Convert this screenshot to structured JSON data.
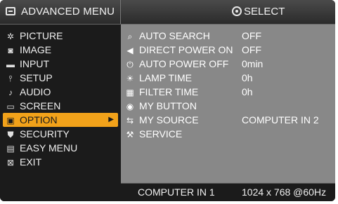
{
  "header": {
    "title": "ADVANCED MENU",
    "select_label": "SELECT"
  },
  "sidebar": {
    "items": [
      {
        "label": "PICTURE",
        "icon": "picture-icon"
      },
      {
        "label": "IMAGE",
        "icon": "image-icon"
      },
      {
        "label": "INPUT",
        "icon": "input-icon"
      },
      {
        "label": "SETUP",
        "icon": "setup-icon"
      },
      {
        "label": "AUDIO",
        "icon": "audio-icon"
      },
      {
        "label": "SCREEN",
        "icon": "screen-icon"
      },
      {
        "label": "OPTION",
        "icon": "option-icon",
        "selected": true
      },
      {
        "label": "SECURITY",
        "icon": "security-icon"
      },
      {
        "label": "EASY MENU",
        "icon": "easy-menu-icon"
      },
      {
        "label": "EXIT",
        "icon": "exit-icon"
      }
    ]
  },
  "options": {
    "rows": [
      {
        "label": "AUTO SEARCH",
        "value": "OFF",
        "icon": "auto-search-icon"
      },
      {
        "label": "DIRECT POWER ON",
        "value": "OFF",
        "icon": "direct-power-on-icon"
      },
      {
        "label": "AUTO POWER OFF",
        "value": "0min",
        "icon": "auto-power-off-icon"
      },
      {
        "label": "LAMP TIME",
        "value": "0h",
        "icon": "lamp-time-icon"
      },
      {
        "label": "FILTER TIME",
        "value": "0h",
        "icon": "filter-time-icon"
      },
      {
        "label": "MY BUTTON",
        "value": "",
        "icon": "my-button-icon"
      },
      {
        "label": "MY SOURCE",
        "value": "COMPUTER IN 2",
        "icon": "my-source-icon"
      },
      {
        "label": "SERVICE",
        "value": "",
        "icon": "service-icon"
      }
    ]
  },
  "status": {
    "source": "COMPUTER IN 1",
    "resolution": "1024 x 768 @60Hz"
  },
  "colors": {
    "selected": "#f2a21a",
    "panel": "#888888",
    "background": "#1b1b1b"
  }
}
